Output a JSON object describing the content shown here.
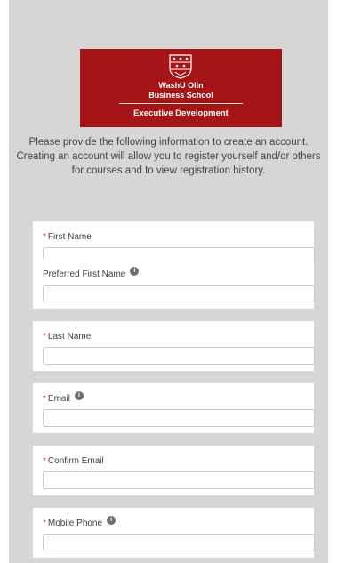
{
  "logo": {
    "line1": "WashU Olin",
    "line2": "Business School",
    "line3": "Executive Development",
    "color": "#a51417"
  },
  "intro_text": "Please provide the following information to create an account. Creating an account will allow you to register yourself and/or others for courses and to view registration history.",
  "required_marker": "*",
  "info_marker": "i",
  "fields": [
    {
      "label": "First Name",
      "required": true,
      "info": false,
      "value": ""
    },
    {
      "label": "Preferred First Name",
      "required": false,
      "info": true,
      "value": ""
    },
    {
      "label": "Last Name",
      "required": true,
      "info": false,
      "value": ""
    },
    {
      "label": "Email",
      "required": true,
      "info": true,
      "value": ""
    },
    {
      "label": "Confirm Email",
      "required": true,
      "info": false,
      "value": ""
    },
    {
      "label": "Mobile Phone",
      "required": true,
      "info": true,
      "value": ""
    }
  ],
  "colors": {
    "background": "#d6d6d6",
    "required": "#c23934",
    "card": "#ffffff"
  }
}
